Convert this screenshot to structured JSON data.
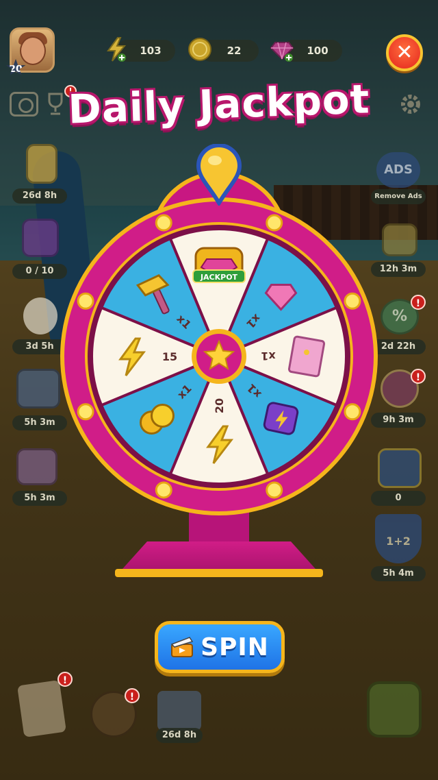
{
  "hud": {
    "player_level": "20",
    "energy": "103",
    "coins": "22",
    "gems": "100"
  },
  "title": "Daily Jackpot",
  "left_timers": [
    "26d 8h",
    "0 / 10",
    "3d 5h",
    "5h 3m",
    "5h 3m"
  ],
  "right_timers": [
    "Remove Ads",
    "12h 3m",
    "2d 22h",
    "9h 3m",
    "0",
    "5h 4m"
  ],
  "ads_badge": "ADS",
  "magic_hat_label": "1+2",
  "bottom_timer": "26d 8h",
  "alert_mark": "!",
  "wheel": {
    "segments": [
      {
        "prize": "jackpot",
        "icon": "jackpot-chest-icon",
        "label": "JACKPOT",
        "amount": "",
        "color": "#fbf5e8"
      },
      {
        "prize": "gems",
        "icon": "gem-icon",
        "amount": "x1",
        "color": "#3ab1e2"
      },
      {
        "prize": "sticker-pack",
        "icon": "card-pack-icon",
        "amount": "x1",
        "color": "#fbf5e8"
      },
      {
        "prize": "dice-booster",
        "icon": "dice-icon",
        "amount": "x1",
        "color": "#3ab1e2"
      },
      {
        "prize": "energy",
        "icon": "lightning-icon",
        "amount": "20",
        "color": "#fbf5e8"
      },
      {
        "prize": "coins",
        "icon": "coin-stack-icon",
        "amount": "x1",
        "color": "#3ab1e2"
      },
      {
        "prize": "energy",
        "icon": "lightning-icon",
        "amount": "15",
        "color": "#fbf5e8"
      },
      {
        "prize": "hammer",
        "icon": "hammer-icon",
        "amount": "x1",
        "color": "#3ab1e2"
      }
    ],
    "hub_icon": "star-icon",
    "rim_color": "#d01d88",
    "gold_color": "#f5b51c"
  },
  "spin_button": {
    "label": "SPIN",
    "icon": "clapperboard-icon"
  }
}
